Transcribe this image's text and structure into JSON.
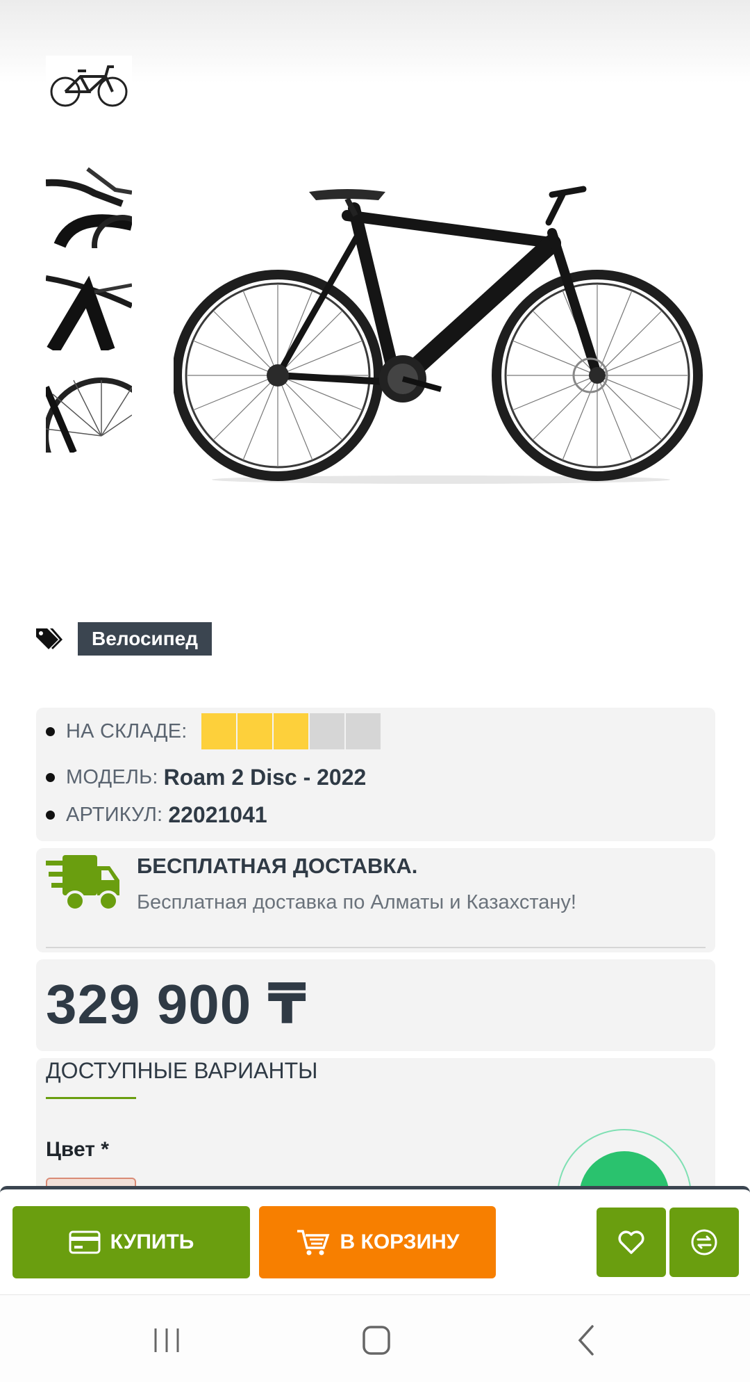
{
  "product": {
    "category_tag": "Велосипед",
    "specs": {
      "stock_label": "НА СКЛАДЕ:",
      "stock_level": 3,
      "stock_max": 5,
      "model_label": "МОДЕЛЬ:",
      "model_value": "Roam 2 Disc - 2022",
      "sku_label": "АРТИКУЛ:",
      "sku_value": "22021041"
    },
    "delivery": {
      "title": "БЕСПЛАТНАЯ ДОСТАВКА.",
      "text": "Бесплатная доставка по Алматы и Казахстану!"
    },
    "price": "329 900 ₸",
    "variants": {
      "title": "ДОСТУПНЫЕ ВАРИАНТЫ",
      "color_label": "Цвет *"
    }
  },
  "actions": {
    "buy_label": "КУПИТЬ",
    "cart_label": "В КОРЗИНУ"
  },
  "icons": {
    "tag": "tags-icon",
    "delivery": "delivery-truck-icon",
    "buy": "credit-card-icon",
    "cart": "cart-icon",
    "favorite": "heart-icon",
    "compare": "compare-icon",
    "nav_recent": "recent-apps-icon",
    "nav_home": "home-icon",
    "nav_back": "back-icon"
  },
  "colors": {
    "accent_green": "#6a9e0f",
    "accent_orange": "#f77f00",
    "stock_filled": "#fdd03b",
    "stock_empty": "#d6d6d6",
    "dark_text": "#2f3a45",
    "chat_green": "#2ac26e"
  }
}
